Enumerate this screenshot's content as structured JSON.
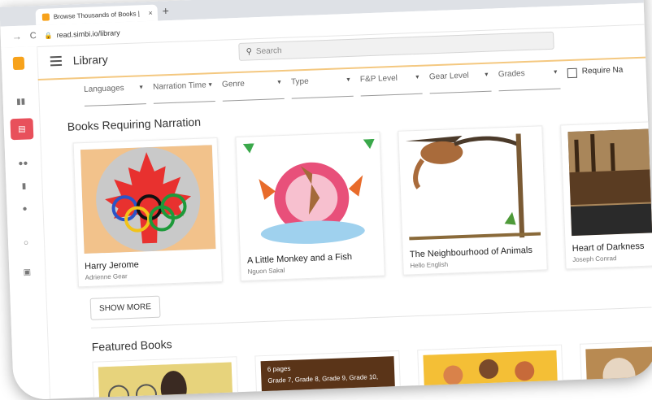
{
  "browser": {
    "tab_title": "Browse Thousands of Books |",
    "tab_close": "×",
    "new_tab": "+",
    "url": "read.simbi.io/library"
  },
  "header": {
    "title": "Library",
    "search_placeholder": "Search"
  },
  "filters": [
    {
      "label": "Languages"
    },
    {
      "label": "Narration Time"
    },
    {
      "label": "Genre"
    },
    {
      "label": "Type"
    },
    {
      "label": "F&P Level"
    },
    {
      "label": "Gear Level"
    },
    {
      "label": "Grades"
    }
  ],
  "require_label": "Require Na",
  "sections": {
    "narration": {
      "title": "Books Requiring Narration",
      "books": [
        {
          "title": "Harry Jerome",
          "author": "Adrienne Gear"
        },
        {
          "title": "A Little Monkey and a Fish",
          "author": "Nguon Sakal"
        },
        {
          "title": "The Neighbourhood of Animals",
          "author": "Hello English"
        },
        {
          "title": "Heart of Darkness",
          "author": "Joseph Conrad"
        }
      ]
    },
    "show_more": "SHOW MORE",
    "featured": {
      "title": "Featured Books",
      "card2_pages": "6 pages",
      "card2_grades": "Grade 7, Grade 8, Grade 9, Grade 10,"
    }
  },
  "colors": {
    "brand": "#f7a21b",
    "active_nav": "#e8505b",
    "header_rule": "#f4c880"
  },
  "icons": [
    "simbi-logo-icon",
    "hamburger-icon",
    "search-icon",
    "lock-icon",
    "reload-icon",
    "back-arrow-icon",
    "caret-down-icon",
    "checkbox-icon"
  ]
}
